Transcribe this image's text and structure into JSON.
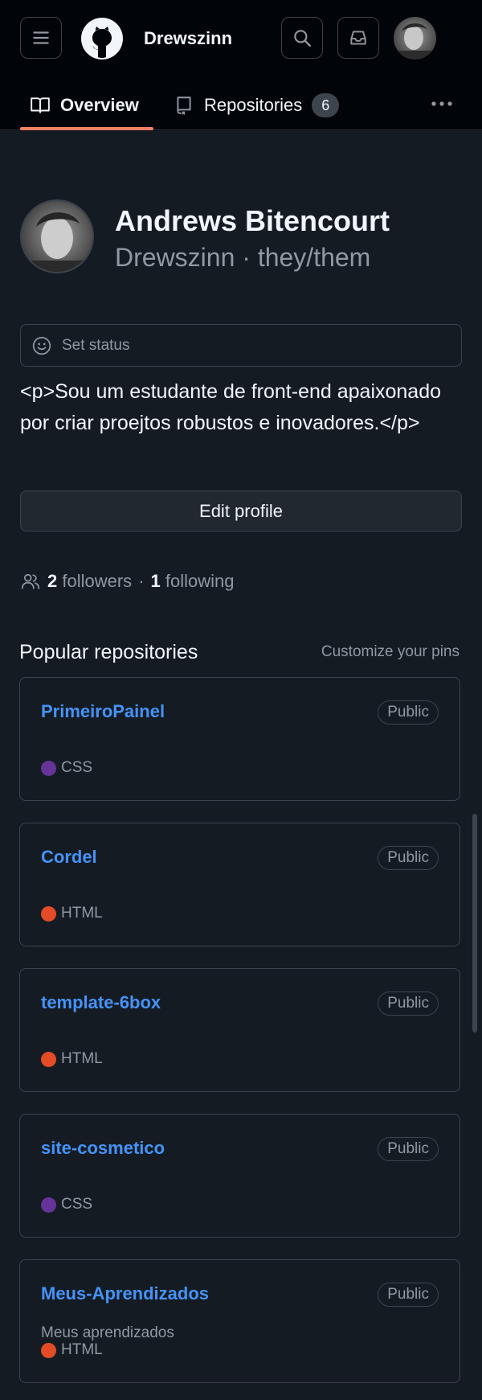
{
  "header": {
    "username": "Drewszinn",
    "menu_icon": "hamburger-menu-icon",
    "logo_icon": "github-mark-icon",
    "search_icon": "search-icon",
    "inbox_icon": "inbox-icon"
  },
  "tabs": [
    {
      "label": "Overview",
      "icon": "book-icon",
      "selected": true
    },
    {
      "label": "Repositories",
      "icon": "repo-icon",
      "count": "6"
    }
  ],
  "profile": {
    "name": "Andrews Bitencourt",
    "login": "Drewszinn",
    "separator": "·",
    "pronouns": "they/them",
    "status_placeholder": "Set status",
    "bio": "<p>Sou um estudante de front-end apaixonado por criar proejtos robustos e inovadores.</p>",
    "edit_label": "Edit profile",
    "followers_count": "2",
    "followers_label": "followers",
    "following_count": "1",
    "following_label": "following"
  },
  "popular": {
    "title": "Popular repositories",
    "customize_label": "Customize your pins",
    "repos": [
      {
        "name": "PrimeiroPainel",
        "visibility": "Public",
        "description": "",
        "language": "CSS",
        "language_color": "#663399"
      },
      {
        "name": "Cordel",
        "visibility": "Public",
        "description": "",
        "language": "HTML",
        "language_color": "#e34c26"
      },
      {
        "name": "template-6box",
        "visibility": "Public",
        "description": "",
        "language": "HTML",
        "language_color": "#e34c26"
      },
      {
        "name": "site-cosmetico",
        "visibility": "Public",
        "description": "",
        "language": "CSS",
        "language_color": "#663399"
      },
      {
        "name": "Meus-Aprendizados",
        "visibility": "Public",
        "description": "Meus aprendizados",
        "language": "HTML",
        "language_color": "#e34c26"
      }
    ]
  },
  "colors": {
    "accent_link": "#4493f8",
    "tab_underline": "#f78166",
    "bg": "#0d1117"
  }
}
